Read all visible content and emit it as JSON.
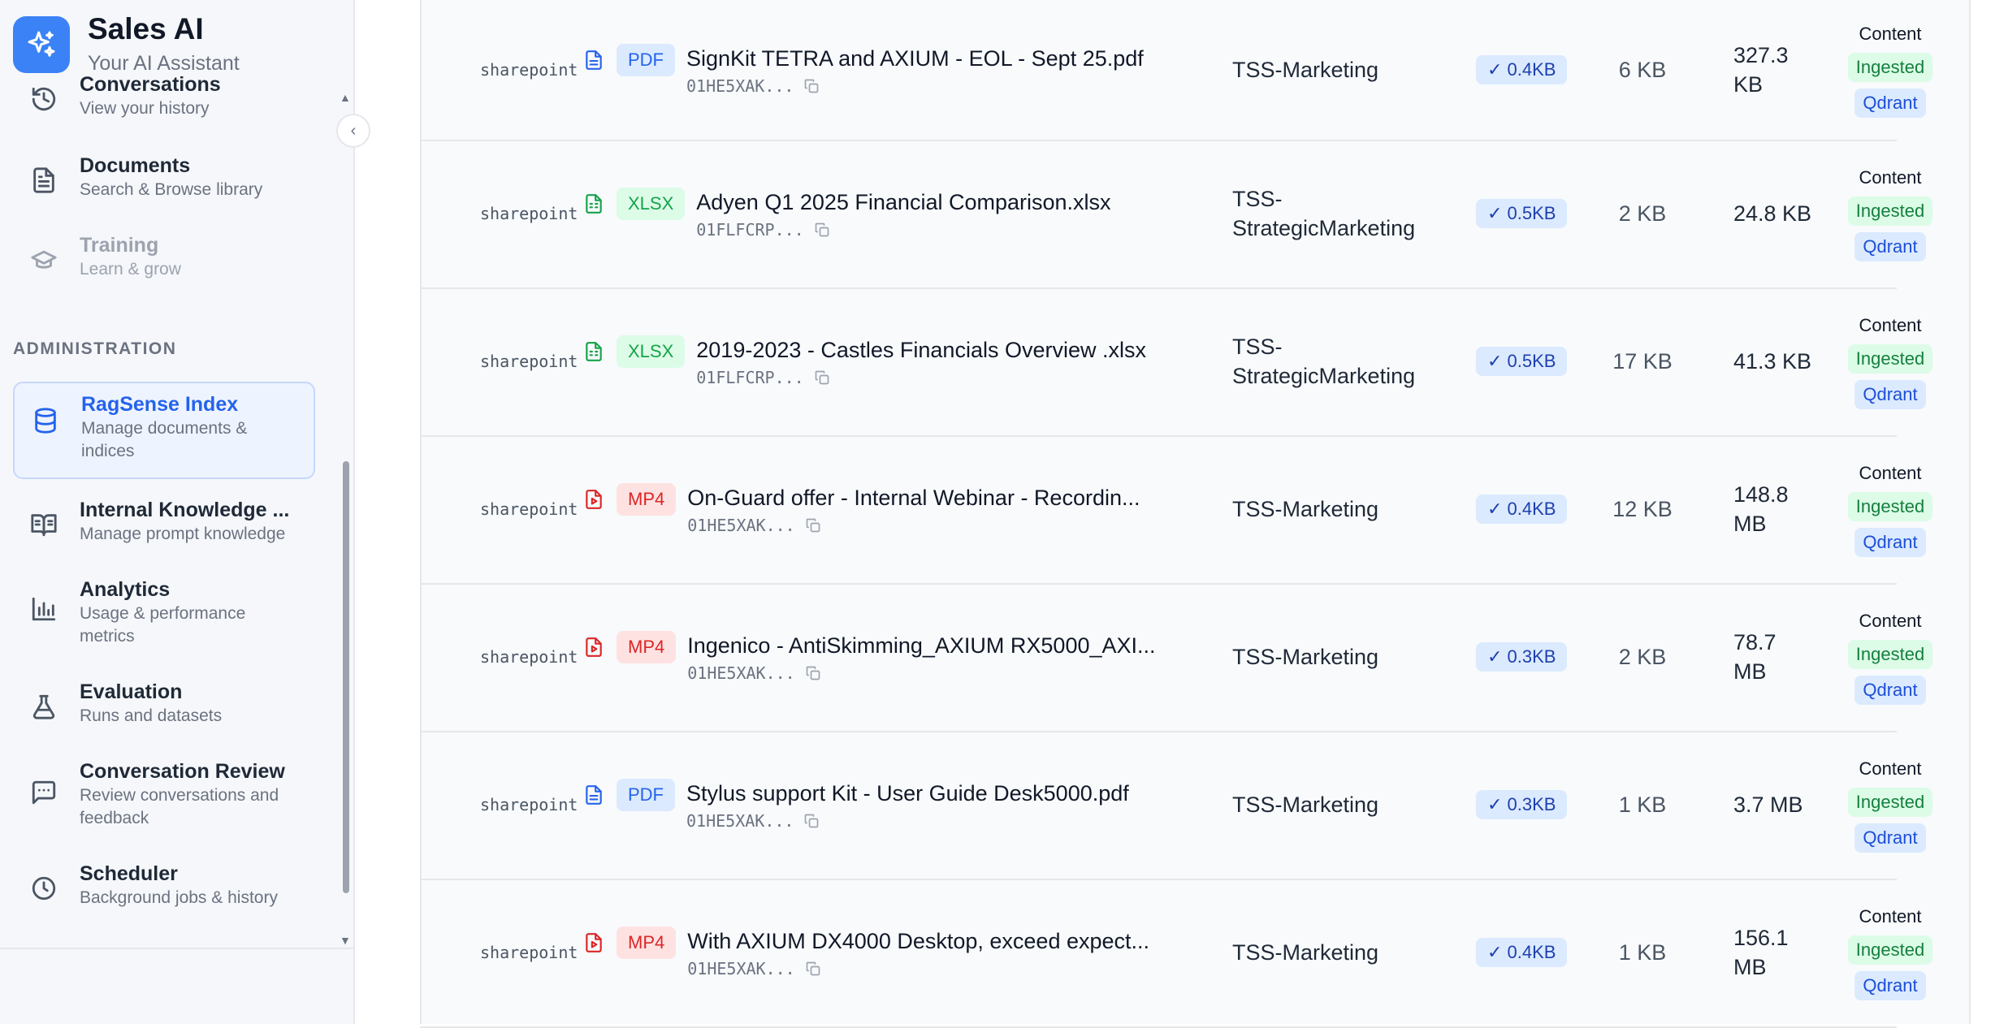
{
  "brand": {
    "title": "Sales AI",
    "subtitle": "Your AI Assistant"
  },
  "sidebar": {
    "items_top": [
      {
        "title": "Conversations",
        "desc": "View your history",
        "icon": "history-icon"
      },
      {
        "title": "Documents",
        "desc": "Search & Browse library",
        "icon": "document-icon"
      },
      {
        "title": "Training",
        "desc": "Learn & grow",
        "icon": "graduation-cap-icon"
      }
    ],
    "section_label": "ADMINISTRATION",
    "items_admin": [
      {
        "title": "RagSense Index",
        "desc": "Manage documents & indices",
        "icon": "database-icon",
        "active": true
      },
      {
        "title": "Internal Knowledge ...",
        "desc": "Manage prompt knowledge",
        "icon": "book-open-icon"
      },
      {
        "title": "Analytics",
        "desc": "Usage & performance metrics",
        "icon": "bar-chart-icon"
      },
      {
        "title": "Evaluation",
        "desc": "Runs and datasets",
        "icon": "flask-icon"
      },
      {
        "title": "Conversation Review",
        "desc": "Review conversations and feedback",
        "icon": "message-square-icon"
      },
      {
        "title": "Scheduler",
        "desc": "Background jobs & history",
        "icon": "clock-icon"
      }
    ]
  },
  "rows": [
    {
      "source": "sharepoint",
      "type": "PDF",
      "name": "SignKit TETRA and AXIUM - EOL - Sept 25.pdf",
      "id": "01HE5XAK...",
      "site": "TSS-Marketing",
      "check": "✓ 0.4KB",
      "kb": "6 KB",
      "size": "327.3 KB",
      "status": "Content",
      "ingested": "Ingested",
      "qdrant": "Qdrant"
    },
    {
      "source": "sharepoint",
      "type": "XLSX",
      "name": "Adyen Q1 2025 Financial Comparison.xlsx",
      "id": "01FLFCRP...",
      "site": "TSS-StrategicMarketing",
      "check": "✓ 0.5KB",
      "kb": "2 KB",
      "size": "24.8 KB",
      "status": "Content",
      "ingested": "Ingested",
      "qdrant": "Qdrant"
    },
    {
      "source": "sharepoint",
      "type": "XLSX",
      "name": "2019-2023 - Castles Financials Overview .xlsx",
      "id": "01FLFCRP...",
      "site": "TSS-StrategicMarketing",
      "check": "✓ 0.5KB",
      "kb": "17 KB",
      "size": "41.3 KB",
      "status": "Content",
      "ingested": "Ingested",
      "qdrant": "Qdrant"
    },
    {
      "source": "sharepoint",
      "type": "MP4",
      "name": "On-Guard offer - Internal Webinar - Recordin...",
      "id": "01HE5XAK...",
      "site": "TSS-Marketing",
      "check": "✓ 0.4KB",
      "kb": "12 KB",
      "size": "148.8 MB",
      "status": "Content",
      "ingested": "Ingested",
      "qdrant": "Qdrant"
    },
    {
      "source": "sharepoint",
      "type": "MP4",
      "name": "Ingenico - AntiSkimming_AXIUM RX5000_AXI...",
      "id": "01HE5XAK...",
      "site": "TSS-Marketing",
      "check": "✓ 0.3KB",
      "kb": "2 KB",
      "size": "78.7 MB",
      "status": "Content",
      "ingested": "Ingested",
      "qdrant": "Qdrant"
    },
    {
      "source": "sharepoint",
      "type": "PDF",
      "name": "Stylus support Kit - User Guide Desk5000.pdf",
      "id": "01HE5XAK...",
      "site": "TSS-Marketing",
      "check": "✓ 0.3KB",
      "kb": "1 KB",
      "size": "3.7 MB",
      "status": "Content",
      "ingested": "Ingested",
      "qdrant": "Qdrant"
    },
    {
      "source": "sharepoint",
      "type": "MP4",
      "name": "With AXIUM DX4000 Desktop, exceed expect...",
      "id": "01HE5XAK...",
      "site": "TSS-Marketing",
      "check": "✓ 0.4KB",
      "kb": "1 KB",
      "size": "156.1 MB",
      "status": "Content",
      "ingested": "Ingested",
      "qdrant": "Qdrant"
    }
  ],
  "colors": {
    "accent": "#3b82f6",
    "pdf": "#2563eb",
    "xlsx": "#16a34a",
    "mp4": "#dc2626"
  }
}
